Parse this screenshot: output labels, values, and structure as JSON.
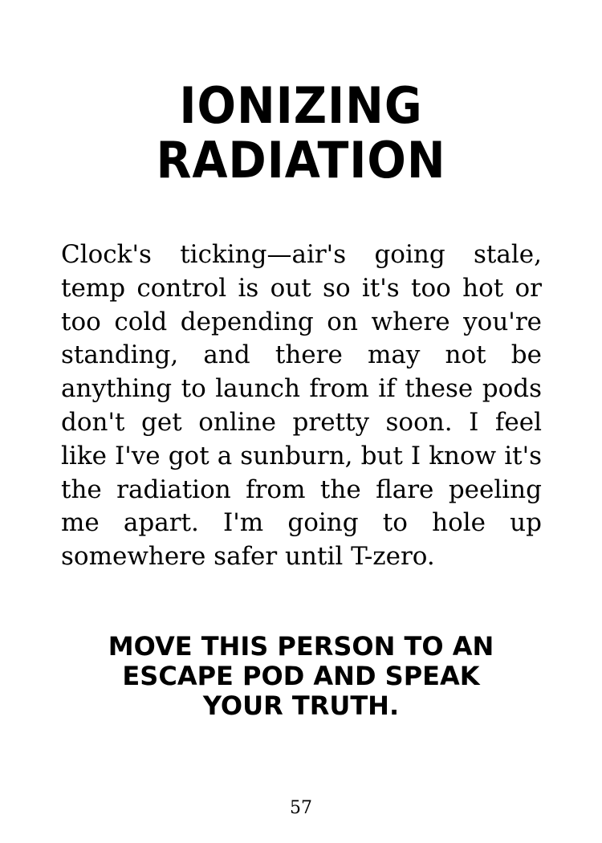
{
  "title": {
    "line1": "IONIZING",
    "line2": "RADIATION"
  },
  "body": "Clock's ticking—air's going stale, temp control is out so it's too hot or too cold depending on where you're standing, and there may not be anything to launch from if these pods don't get online pretty soon. I feel like I've got a sunburn, but I know it's the radiation from the flare peeling me apart. I'm going to hole up somewhere safer until T-zero.",
  "instruction": {
    "line1": "MOVE THIS PERSON TO AN",
    "line2": "ESCAPE POD AND SPEAK",
    "line3": "YOUR TRUTH."
  },
  "page_number": "57"
}
